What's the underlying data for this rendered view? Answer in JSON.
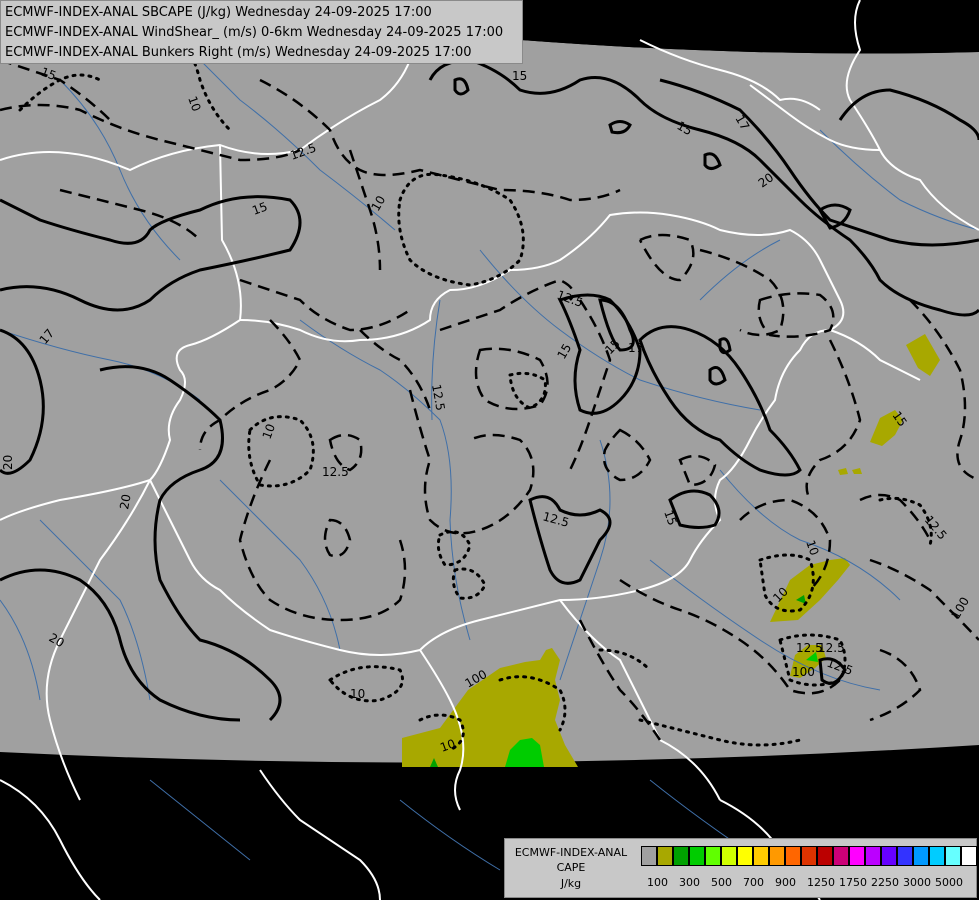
{
  "header": {
    "lines": [
      "ECMWF-INDEX-ANAL SBCAPE (J/kg) Wednesday 24-09-2025 17:00",
      "ECMWF-INDEX-ANAL WindShear_ (m/s) 0-6km Wednesday 24-09-2025 17:00",
      "ECMWF-INDEX-ANAL Bunkers Right (m/s) Wednesday 24-09-2025 17:00"
    ]
  },
  "legend": {
    "title": [
      "ECMWF-INDEX-ANAL",
      "CAPE",
      "J/kg"
    ],
    "colors": [
      "#a0a0a0",
      "#a8a800",
      "#00a000",
      "#00cc00",
      "#60ff00",
      "#d0ff00",
      "#ffff00",
      "#ffcc00",
      "#ff9900",
      "#ff6600",
      "#dd3300",
      "#bb0000",
      "#cc0077",
      "#ff00ff",
      "#bb00ff",
      "#6600ff",
      "#3333ff",
      "#0099ff",
      "#00ccff",
      "#66ffff",
      "#ffffff"
    ],
    "ticks": [
      "100",
      "300",
      "500",
      "700",
      "900",
      "1250",
      "1750",
      "2250",
      "3000",
      "5000"
    ]
  },
  "contour_labels": [
    "15",
    "10",
    "12.5",
    "15",
    "17",
    "15",
    "12.5",
    "15",
    "15",
    "17",
    "10",
    "20",
    "20",
    "20",
    "20",
    "10",
    "12.5",
    "10",
    "12.5",
    "15",
    "17",
    "12.5",
    "15",
    "15",
    "12.5",
    "10",
    "10",
    "100",
    "12.5",
    "100",
    "12.5",
    "100",
    "10",
    "12.5"
  ]
}
